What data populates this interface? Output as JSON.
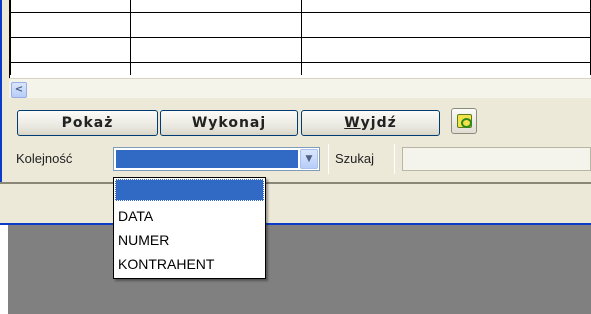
{
  "grid": {
    "rows": [
      [
        "",
        "",
        ""
      ],
      [
        "",
        "",
        ""
      ],
      [
        "",
        "",
        ""
      ],
      [
        "",
        "",
        ""
      ]
    ]
  },
  "scrollbar": {
    "left_arrow": "<"
  },
  "toolbar": {
    "show_label": "Pokaż",
    "exec_label": "Wykonaj",
    "exit_prefix": "",
    "exit_underlined": "W",
    "exit_rest": "yjdź"
  },
  "filter": {
    "order_label": "Kolejność",
    "order_value": "",
    "search_label": "Szukaj",
    "search_value": ""
  },
  "dropdown": {
    "options": [
      "",
      "DATA",
      "NUMER",
      "KONTRAHENT"
    ],
    "selected_index": 0
  },
  "colors": {
    "accent": "#316ac5",
    "frame_blue": "#0a3cc9",
    "panel": "#ece9d8",
    "dark_area": "#808080"
  },
  "icons": {
    "scroll_left": "arrow-left-icon",
    "combo_arrow": "chevron-down-icon",
    "refresh": "refresh-icon"
  }
}
